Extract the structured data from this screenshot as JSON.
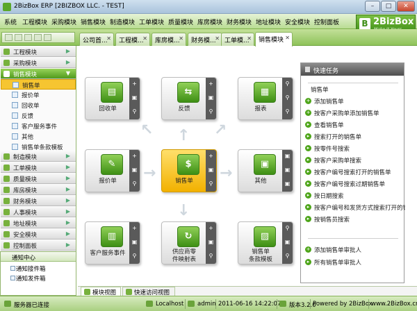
{
  "window": {
    "title": "2BizBox ERP [2BIZBOX LLC. - TEST]",
    "min": "–",
    "max": "□",
    "close": "✕"
  },
  "menubar": [
    "系统",
    "工程模块",
    "采购模块",
    "销售模块",
    "制造模块",
    "工单模块",
    "质量模块",
    "库房模块",
    "财务模块",
    "地址模块",
    "安全模块",
    "控制面板"
  ],
  "logo": {
    "mark": "B",
    "brand": "2BizBox",
    "slogan": "Make It Yours"
  },
  "tabs": [
    {
      "label": "公司首..."
    },
    {
      "label": "工程模..."
    },
    {
      "label": "库房模..."
    },
    {
      "label": "财务模..."
    },
    {
      "label": "工单模..."
    },
    {
      "label": "销售模块"
    }
  ],
  "sidebar": {
    "top_items": [
      {
        "label": "工程模块",
        "icon": "engineering-icon"
      },
      {
        "label": "采购模块",
        "icon": "purchase-icon"
      },
      {
        "label": "销售模块",
        "icon": "sales-icon"
      }
    ],
    "sub_items": [
      {
        "label": "销售单",
        "icon": "doc-icon"
      },
      {
        "label": "报价单",
        "icon": "doc-icon"
      },
      {
        "label": "回收单",
        "icon": "doc-icon"
      },
      {
        "label": "反馈",
        "icon": "doc-icon"
      },
      {
        "label": "客户服务事件",
        "icon": "doc-icon"
      },
      {
        "label": "其他",
        "icon": "doc-icon"
      },
      {
        "label": "销售单条款模板",
        "icon": "doc-icon"
      }
    ],
    "bottom_items": [
      {
        "label": "制造模块"
      },
      {
        "label": "工单模块"
      },
      {
        "label": "质量模块"
      },
      {
        "label": "库房模块"
      },
      {
        "label": "财务模块"
      },
      {
        "label": "人事模块"
      },
      {
        "label": "地址模块"
      },
      {
        "label": "安全模块"
      },
      {
        "label": "控制面板"
      }
    ]
  },
  "notify": {
    "title": "通知中心",
    "items": [
      "通知接件箱",
      "通知发件箱"
    ]
  },
  "tiles": [
    {
      "label": "回收单",
      "glyph": "▤"
    },
    {
      "label": "反馈",
      "glyph": "⇆"
    },
    {
      "label": "报表",
      "glyph": "▦"
    },
    {
      "label": "报价单",
      "glyph": "✎"
    },
    {
      "label": "销售单",
      "glyph": "$"
    },
    {
      "label": "其他",
      "glyph": "▣"
    },
    {
      "label": "客户服务事件",
      "glyph": "▥"
    },
    {
      "label": "供应商零",
      "label2": "件映射表",
      "glyph": "↻"
    },
    {
      "label": "销售单",
      "label2": "条款模板",
      "glyph": "▨"
    }
  ],
  "tile_buttons": {
    "add": "+",
    "edit": "▣",
    "search": "⚲"
  },
  "bottom_tabs": [
    "模块视图",
    "快速访问视图"
  ],
  "quick": {
    "title": "快速任务",
    "section": "销售单",
    "items": [
      "添加销售单",
      "按客户采购单添加销售单",
      "查看销售单",
      "搜索打开的销售单",
      "按零件号搜索",
      "按客户采购单搜索",
      "按客户编号搜索打开的销售单",
      "按客户编号搜索过期销售单",
      "按日期搜索",
      "按客户编号和发货方式搜索打开的销",
      "按销售员搜索"
    ],
    "bottom_items": [
      "添加销售单审批人",
      "所有销售单审批人"
    ]
  },
  "status": {
    "connection": "服务器已连接",
    "host": "Localhost",
    "user": "admin",
    "datetime": "2011-06-16 14:22:07",
    "version": "版本3.2.0",
    "powered": "Powered by 2BizBox",
    "url": "www.2BizBox.cn"
  }
}
